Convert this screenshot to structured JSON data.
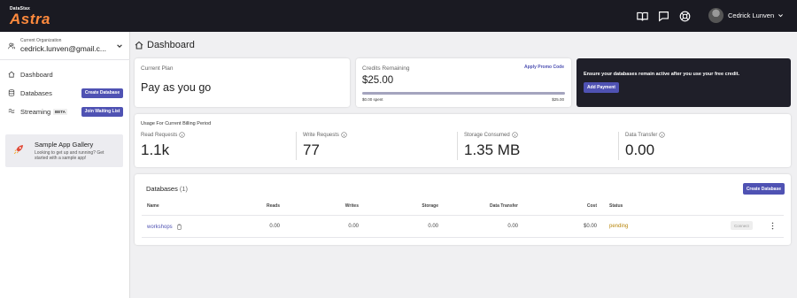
{
  "header": {
    "logo_small": "DataStax",
    "logo_big": "Astra",
    "icons": [
      "book-icon",
      "chat-icon",
      "help-icon"
    ],
    "user_name": "Cedrick Lunven"
  },
  "sidebar": {
    "org_label": "Current Organization",
    "org_value": "cedrick.lunven@gmail.c...",
    "items": [
      {
        "label": "Dashboard",
        "icon": "home-icon"
      },
      {
        "label": "Databases",
        "icon": "database-icon",
        "button": "Create Database"
      },
      {
        "label": "Streaming",
        "icon": "stream-icon",
        "badge": "BETA",
        "button": "Join Waiting List"
      }
    ],
    "gallery": {
      "title": "Sample App Gallery",
      "text": "Looking to get up and running? Get started with a sample app!"
    }
  },
  "main": {
    "page_title": "Dashboard",
    "current_plan": {
      "label": "Current Plan",
      "value": "Pay as you go"
    },
    "credits": {
      "label": "Credits Remaining",
      "link": "Apply Promo Code",
      "value": "$25.00",
      "progress": 1.0,
      "spent": "$0.00 spent",
      "max": "$25.00"
    },
    "promo": {
      "text": "Ensure your databases remain active after you use your free credit.",
      "button": "Add Payment"
    },
    "usage": {
      "title": "Usage For Current Billing Period",
      "metrics": [
        {
          "label": "Read Requests",
          "value": "1.1k"
        },
        {
          "label": "Write Requests",
          "value": "77"
        },
        {
          "label": "Storage Consumed",
          "value": "1.35 MB"
        },
        {
          "label": "Data Transfer",
          "value": "0.00"
        }
      ]
    },
    "databases": {
      "title": "Databases",
      "count": "(1)",
      "create_button": "Create Database",
      "columns": [
        "Name",
        "Reads",
        "Writes",
        "Storage",
        "Data Transfer",
        "Cost",
        "Status"
      ],
      "rows": [
        {
          "name": "workshops",
          "reads": "0.00",
          "writes": "0.00",
          "storage": "0.00",
          "transfer": "0.00",
          "cost": "$0.00",
          "status": "pending",
          "action": "Connect"
        }
      ]
    }
  },
  "colors": {
    "accent": "#4f52b3",
    "topbar": "#1a1a22",
    "brand": "#ff8a3d",
    "pending": "#b8860b"
  }
}
